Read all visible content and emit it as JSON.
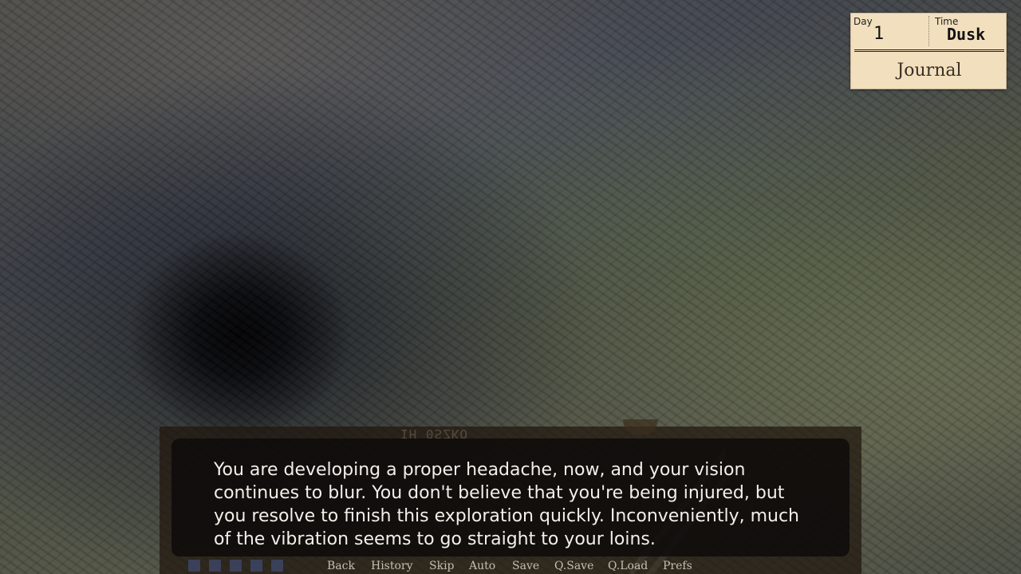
{
  "hud": {
    "day_label": "Day",
    "day_value": "1",
    "time_label": "Time",
    "time_value": "Dusk",
    "journal_label": "Journal"
  },
  "dialogue": {
    "deco_label": "IH 0SZKO",
    "text": "You are developing a proper headache, now, and your vision continues to blur. You don't believe that you're being injured, but you resolve to finish this exploration quickly. Inconveniently, much of the vibration seems to go straight to your loins."
  },
  "quick_menu": {
    "items": [
      "Back",
      "History",
      "Skip",
      "Auto",
      "Save",
      "Q.Save",
      "Q.Load",
      "Prefs"
    ]
  },
  "colors": {
    "hud_bg": "#f2dfbe",
    "dialogue_text": "#f3efe9",
    "quick_menu_text": "#c6bfb3",
    "indicator_squares": "#3d4564"
  }
}
